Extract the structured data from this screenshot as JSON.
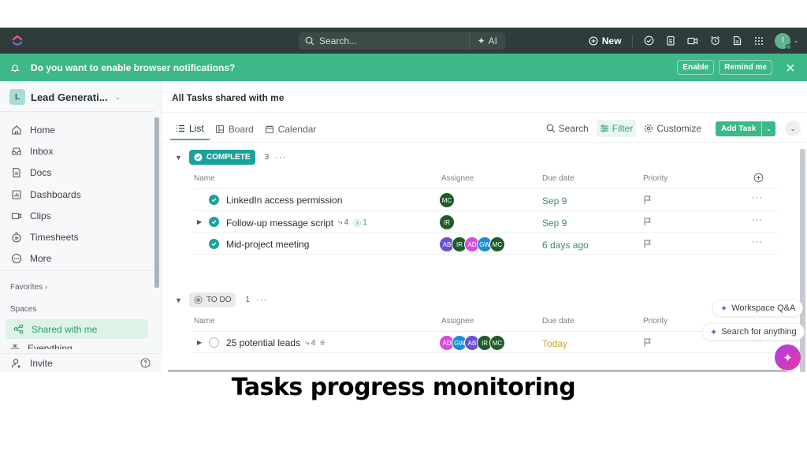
{
  "topbar": {
    "search_placeholder": "Search...",
    "ai_label": "AI",
    "new_label": "New",
    "icons": [
      "check-circle-icon",
      "notepad-icon",
      "video-icon",
      "alarm-icon",
      "doc-icon",
      "apps-grid-icon"
    ],
    "user_initial": "I"
  },
  "notification": {
    "message": "Do you want to enable browser notifications?",
    "enable_label": "Enable",
    "remind_label": "Remind me"
  },
  "sidebar": {
    "workspace_initial": "L",
    "workspace_name": "Lead Generati...",
    "nav": [
      {
        "label": "Home",
        "icon": "home-icon"
      },
      {
        "label": "Inbox",
        "icon": "inbox-icon"
      },
      {
        "label": "Docs",
        "icon": "docs-icon"
      },
      {
        "label": "Dashboards",
        "icon": "dashboards-icon"
      },
      {
        "label": "Clips",
        "icon": "clips-icon"
      },
      {
        "label": "Timesheets",
        "icon": "timesheets-icon"
      },
      {
        "label": "More",
        "icon": "more-icon"
      }
    ],
    "favorites_label": "Favorites",
    "spaces_label": "Spaces",
    "shared_label": "Shared with me",
    "everything_label": "Everything",
    "invite_label": "Invite"
  },
  "main": {
    "title": "All Tasks shared with me",
    "views": [
      "List",
      "Board",
      "Calendar"
    ],
    "toolbar": {
      "search_label": "Search",
      "filter_label": "Filter",
      "customize_label": "Customize",
      "add_task_label": "Add Task"
    },
    "columns": {
      "name": "Name",
      "assignee": "Assignee",
      "due": "Due date",
      "priority": "Priority"
    },
    "groups": [
      {
        "status": "COMPLETE",
        "count": "3",
        "tasks": [
          {
            "name": "LinkedIn access permission",
            "assignees": [
              "MC"
            ],
            "due": "Sep 9"
          },
          {
            "name": "Follow-up message script",
            "subtasks": "4",
            "checklist": "1",
            "assignees": [
              "IR"
            ],
            "due": "Sep 9"
          },
          {
            "name": "Mid-project meeting",
            "assignees": [
              "AB",
              "IR",
              "AD",
              "GW",
              "MC"
            ],
            "due": "6 days ago"
          }
        ]
      },
      {
        "status": "TO DO",
        "count": "1",
        "tasks": [
          {
            "name": "25 potential leads",
            "subtasks": "4",
            "assignees": [
              "AD",
              "GW",
              "AB",
              "IR",
              "MC"
            ],
            "due": "Today"
          }
        ]
      }
    ]
  },
  "ai_assist": {
    "workspace_qa": "Workspace Q&A",
    "search_anything": "Search for anything"
  },
  "colors": {
    "accent": "#3db888",
    "complete": "#1aa39b",
    "avatar_MC": "#1e5c2a",
    "avatar_IR": "#1e5c2a",
    "avatar_AB": "#6a4fd8",
    "avatar_AD": "#d94be0",
    "avatar_GW": "#1a8fd6",
    "due_today": "#c9a227",
    "due_normal": "#3f8a6a"
  },
  "caption": "Tasks progress monitoring"
}
